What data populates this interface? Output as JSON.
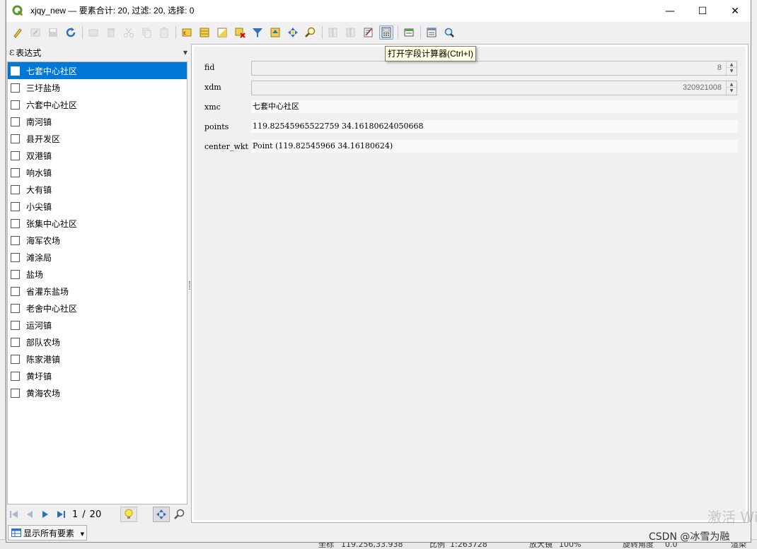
{
  "window": {
    "title": "xjqy_new — 要素合计: 20, 过滤: 20, 选择: 0",
    "minimize": "—",
    "maximize": "☐",
    "close": "✕"
  },
  "toolbar": {
    "icons": [
      "edit-pencil-icon",
      "multi-edit-icon",
      "save-edits-icon",
      "reload-icon",
      "add-feature-icon",
      "delete-feature-icon",
      "cut-icon",
      "copy-icon",
      "paste-icon",
      "select-by-expression-icon",
      "select-all-icon",
      "invert-selection-icon",
      "deselect-all-icon",
      "filter-select-icon",
      "move-selection-top-icon",
      "pan-to-selected-icon",
      "zoom-to-selected-icon",
      "new-field-icon",
      "delete-field-icon",
      "conditional-format-icon",
      "field-calculator-icon",
      "dock-table-icon",
      "actions-icon",
      "zoom-icon"
    ],
    "tooltip": "打开字段计算器(Ctrl+I)"
  },
  "expression": {
    "symbol": "ε",
    "label": "表达式"
  },
  "features": [
    "七套中心社区",
    "三圩盐场",
    "六套中心社区",
    "南河镇",
    "县开发区",
    "双港镇",
    "响水镇",
    "大有镇",
    "小尖镇",
    "张集中心社区",
    "海军农场",
    "滩涂局",
    "盐场",
    "省灌东盐场",
    "老舍中心社区",
    "运河镇",
    "部队农场",
    "陈家港镇",
    "黄圩镇",
    "黄海农场"
  ],
  "selected_index": 0,
  "navigation": {
    "current": "1",
    "sep": "/",
    "total": "20"
  },
  "filter_button": {
    "label": "显示所有要素"
  },
  "form": {
    "fields": [
      {
        "name": "fid",
        "value": "8",
        "type": "spin"
      },
      {
        "name": "xdm",
        "value": "320921008",
        "type": "spin"
      },
      {
        "name": "xmc",
        "value": "七套中心社区",
        "type": "text"
      },
      {
        "name": "points",
        "value": "119.82545965522759 34.16180624050668",
        "type": "text"
      },
      {
        "name": "center_wkt",
        "value": "Point (119.82545966 34.16180624)",
        "type": "text"
      }
    ]
  },
  "background_status": {
    "coord_label": "坐标",
    "coord_value": "119.256,33.938",
    "scale_label": "比例",
    "scale_value": "1:263728",
    "magnifier_label": "放大镜",
    "magnifier_value": "100%",
    "rotation_label": "旋转角度",
    "rotation_value": "0.0",
    "render_label": "渲染"
  },
  "watermark": {
    "activate": "激活 Wi",
    "csdn": "CSDN @冰雪为融"
  },
  "colors": {
    "selection": "#0078d7",
    "tooltip_bg": "#ffffe1",
    "qgis_green": "#589632"
  }
}
